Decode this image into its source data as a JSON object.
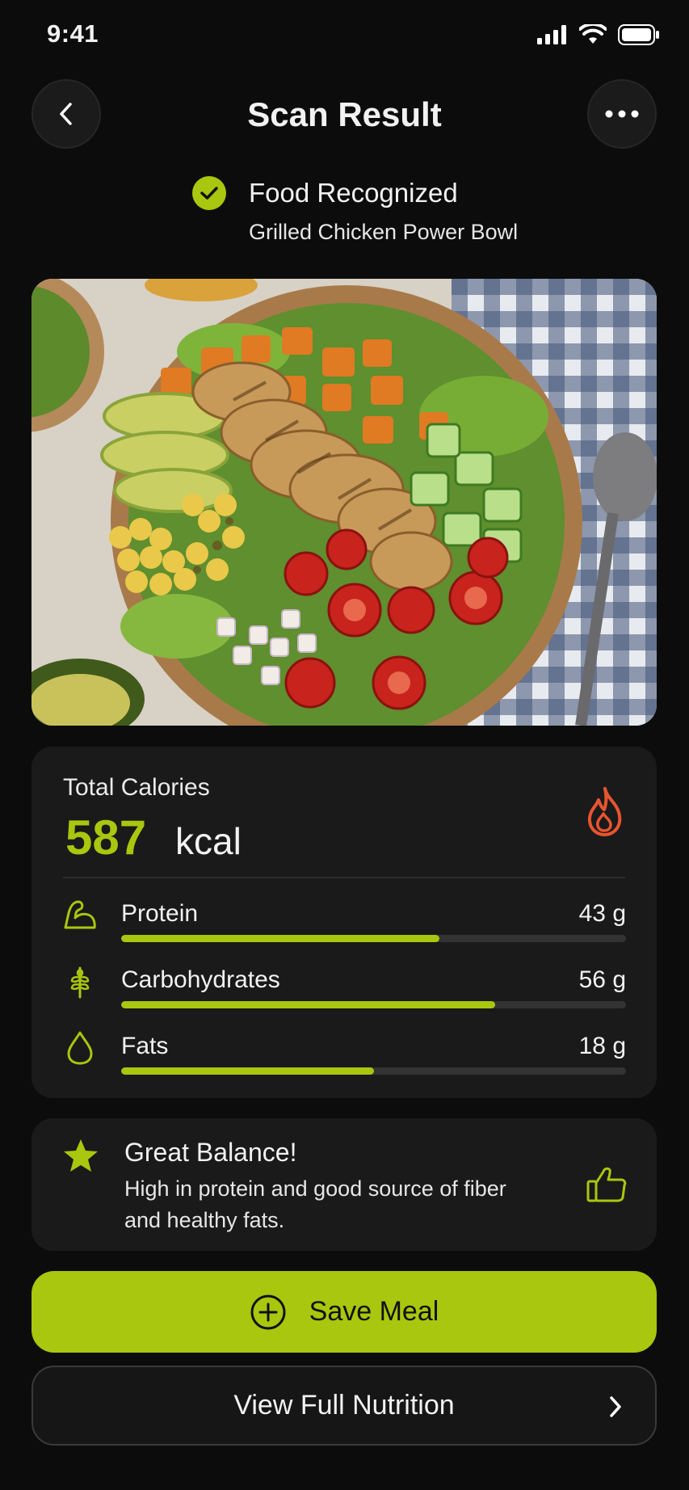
{
  "status_bar": {
    "time": "9:41"
  },
  "header": {
    "title": "Scan Result"
  },
  "recognition": {
    "title": "Food Recognized",
    "food_name": "Grilled Chicken Power Bowl"
  },
  "calories": {
    "label": "Total Calories",
    "value": "587",
    "unit": "kcal"
  },
  "macros": [
    {
      "name": "Protein",
      "value": "43 g",
      "icon": "muscle-icon",
      "fill_fraction": 0.63
    },
    {
      "name": "Carbohydrates",
      "value": "56 g",
      "icon": "wheat-icon",
      "fill_fraction": 0.74
    },
    {
      "name": "Fats",
      "value": "18 g",
      "icon": "droplet-icon",
      "fill_fraction": 0.5
    }
  ],
  "balance": {
    "title": "Great Balance!",
    "text": "High in protein and good source of fiber and healthy fats."
  },
  "actions": {
    "save_label": "Save Meal",
    "view_label": "View Full Nutrition"
  },
  "colors": {
    "accent": "#a8c70e",
    "background": "#0c0c0c",
    "card": "#1a1a1a",
    "flame": "#e8552f"
  }
}
